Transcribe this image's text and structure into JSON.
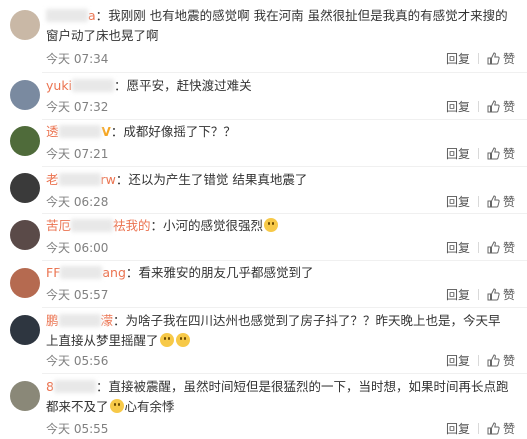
{
  "actions": {
    "reply": "回复",
    "like": "赞"
  },
  "comments": [
    {
      "name": "a",
      "text": "我刚刚  也有地震的感觉啊  我在河南  虽然很扯但是我真的有感觉才来搜的  窗户动了床也晃了啊",
      "time": "今天 07:34",
      "avatar_color": "#c9b8a6"
    },
    {
      "name": "yuki",
      "text": "愿平安，赶快渡过难关",
      "time": "今天 07:32",
      "avatar_color": "#7a8aa0"
    },
    {
      "name": "透",
      "text": "成都好像摇了下？？",
      "time": "今天 07:21",
      "avatar_color": "#4f6b3a"
    },
    {
      "name": "老",
      "name_suffix": "rw",
      "text": "还以为产生了错觉 结果真地震了",
      "time": "今天 06:28",
      "avatar_color": "#3a3a3a"
    },
    {
      "name": "苦厄",
      "name_suffix": "祛我的",
      "text": "小河的感觉很强烈",
      "time": "今天 06:00",
      "avatar_color": "#5a4a48"
    },
    {
      "name": "FF",
      "name_suffix": "ang",
      "text": "看来雅安的朋友几乎都感觉到了",
      "time": "今天 05:57",
      "avatar_color": "#b56a50"
    },
    {
      "name": "鹏",
      "name_suffix": "濛",
      "text": "为啥子我在四川达州也感觉到了房子抖了？？昨天晚上也是，今天早上直接从梦里摇醒了",
      "time": "今天 05:56",
      "avatar_color": "#2e3640"
    },
    {
      "name": "8",
      "text": "直接被震醒，虽然时间短但是很猛烈的一下，当时想，如果时间再长点跑都来不及了",
      "text_suffix": "心有余悸",
      "time": "今天 05:55",
      "avatar_color": "#8a8878"
    }
  ],
  "colors": {
    "username": "#eb7350",
    "meta": "#808080"
  }
}
